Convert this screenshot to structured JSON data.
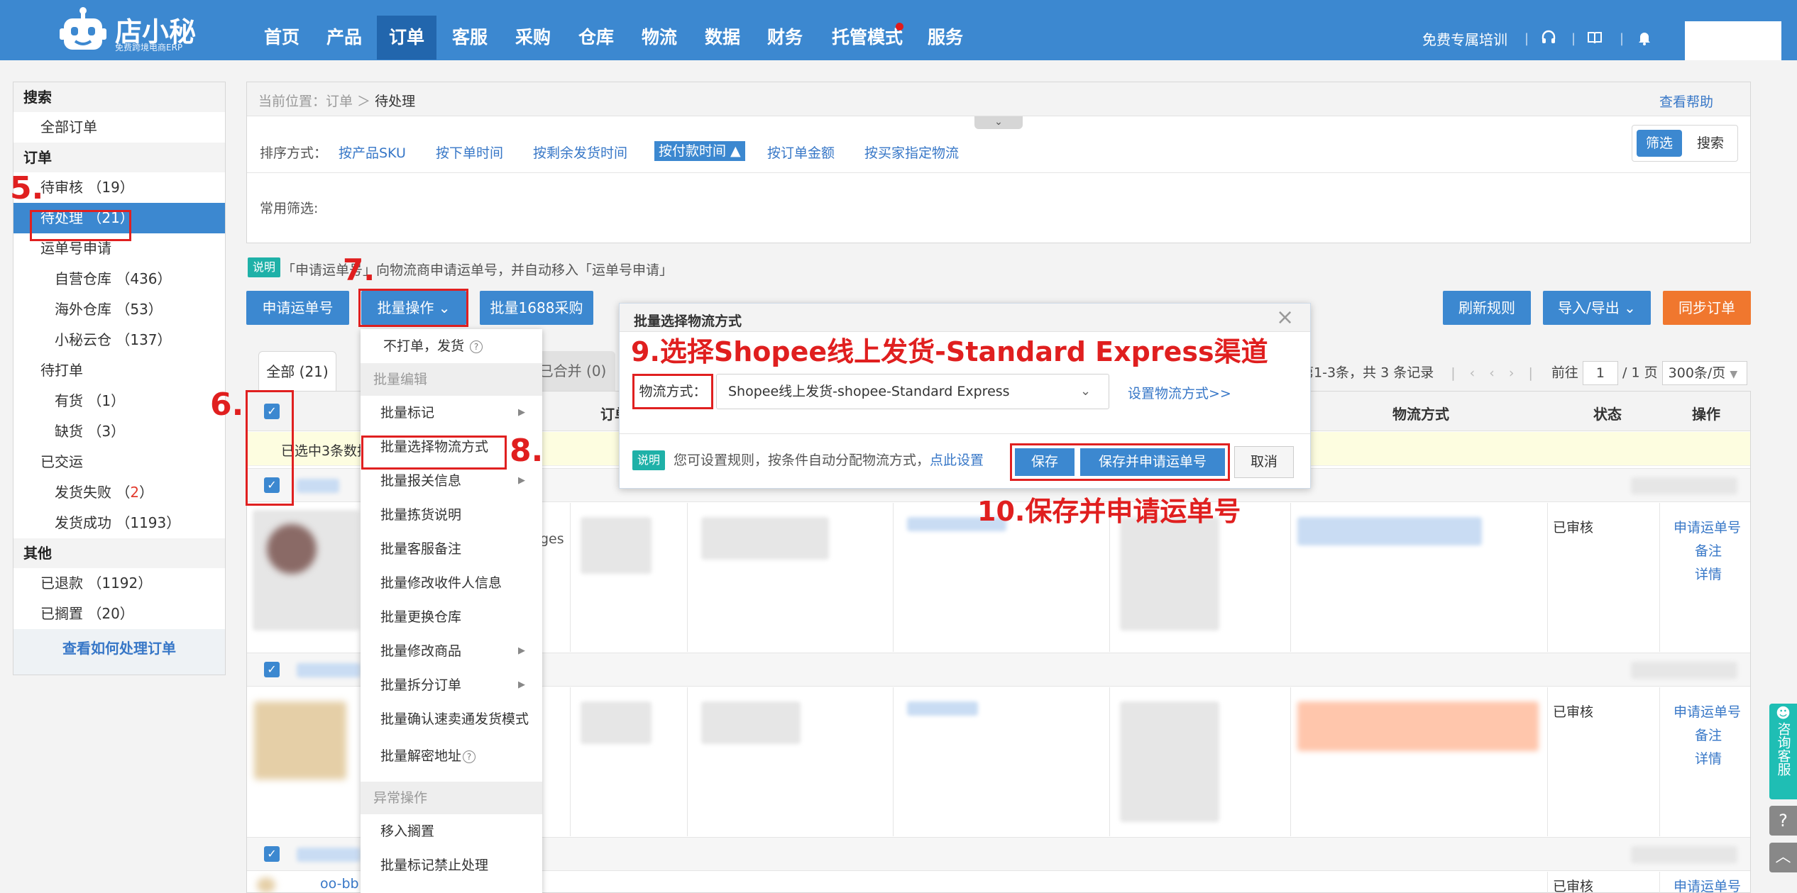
{
  "app": {
    "logo_text": "店小秘",
    "logo_subtitle": "免费跨境电商ERP"
  },
  "nav": {
    "items": [
      "首页",
      "产品",
      "订单",
      "客服",
      "采购",
      "仓库",
      "物流",
      "数据",
      "财务",
      "托管模式",
      "服务"
    ],
    "active_index": 2,
    "training": "免费专属培训",
    "icons": [
      "headset-icon",
      "book-icon",
      "bell-icon"
    ]
  },
  "sidebar": {
    "search": "搜索",
    "all_orders": "全部订单",
    "orders": "订单",
    "pending_review": "待审核 （19）",
    "pending_process": "待处理 （21）",
    "waybill_apply": "运单号申请",
    "own_warehouse": "自营仓库 （436）",
    "overseas_warehouse": "海外仓库 （53）",
    "cloud_warehouse": "小秘云仓 （137）",
    "to_print": "待打单",
    "in_stock": "有货 （1）",
    "out_of_stock": "缺货 （3）",
    "shipped": "已交运",
    "ship_failed": "发货失败 （",
    "ship_failed_count": "2",
    "ship_failed_end": "）",
    "ship_success": "发货成功 （1193）",
    "other": "其他",
    "refunded": "已退款 （1192）",
    "shelved": "已搁置 （20）",
    "how_to": "查看如何处理订单"
  },
  "breadcrumb": {
    "prefix": "当前位置：订单 ＞ ",
    "current": "待处理",
    "help": "查看帮助"
  },
  "sort": {
    "label": "排序方式：",
    "options": [
      "按产品SKU",
      "按下单时间",
      "按剩余发货时间",
      "按付款时间 ▲",
      "按订单金额",
      "按买家指定物流"
    ],
    "active_index": 3
  },
  "toggle": {
    "filter": "筛选",
    "search": "搜索"
  },
  "common_filter": "常用筛选:",
  "info": {
    "badge": "说明",
    "text": "「申请运单号」向物流商申请运单号，并自动移入「运单号申请」"
  },
  "actions": {
    "apply_waybill": "申请运单号",
    "batch_ops": "批量操作 ⌄",
    "batch_1688": "批量1688采购",
    "refresh_rules": "刷新规则",
    "import_export": "导入/导出 ⌄",
    "sync_orders": "同步订单"
  },
  "tabs": {
    "all": "全部 (21)",
    "merged": "已合并 (0)"
  },
  "pagination": {
    "summary": "第1-3条，共 3 条记录",
    "go_to": "前往",
    "page": "1",
    "total_pages": "/ 1 页",
    "per_page": "300条/页"
  },
  "table": {
    "col_order": "订单",
    "col_shipping": "物流方式",
    "col_status": "状态",
    "col_ops": "操作",
    "selected_text": "已选中3条数据",
    "partial_goods": "ges",
    "row_link": "oo-bb",
    "rows": [
      {
        "status": "已审核",
        "op1": "申请运单号",
        "op2": "备注",
        "op3": "详情"
      },
      {
        "status": "已审核",
        "op1": "申请运单号",
        "op2": "备注",
        "op3": "详情"
      },
      {
        "status": "已审核",
        "op1": "申请运单号"
      }
    ]
  },
  "dropdown": {
    "no_print_ship": "不打单，发货",
    "group_batch_edit": "批量编辑",
    "batch_mark": "批量标记",
    "batch_select_shipping": "批量选择物流方式",
    "batch_customs": "批量报关信息",
    "batch_picking_note": "批量拣货说明",
    "batch_cs_note": "批量客服备注",
    "batch_edit_recipient": "批量修改收件人信息",
    "batch_change_warehouse": "批量更换仓库",
    "batch_edit_goods": "批量修改商品",
    "batch_split": "批量拆分订单",
    "batch_confirm_smt": "批量确认速卖通发货模式",
    "batch_decrypt": "批量解密地址",
    "group_exception": "异常操作",
    "move_shelve": "移入搁置",
    "batch_forbid": "批量标记禁止处理"
  },
  "modal": {
    "title": "批量选择物流方式",
    "shipping_label": "物流方式：",
    "shipping_value": "Shopee线上发货-shopee-Standard Express",
    "set_shipping": "设置物流方式>>",
    "note_badge": "说明",
    "note_text": "您可设置规则，按条件自动分配物流方式，",
    "note_link": "点此设置",
    "save": "保存",
    "save_apply": "保存并申请运单号",
    "cancel": "取消"
  },
  "annotations": {
    "a5": "5.",
    "a6": "6.",
    "a7": "7.",
    "a8": "8.",
    "a9": "9.选择Shopee线上发货-Standard Express渠道",
    "a10": "10.保存并申请运单号"
  },
  "floating": {
    "consult": "咨询客服"
  },
  "colors": {
    "primary": "#3c88d0",
    "nav_active": "#2266ad",
    "orange": "#f0772e",
    "annotation_red": "#e01f1f",
    "teal": "#1fb1a8"
  }
}
